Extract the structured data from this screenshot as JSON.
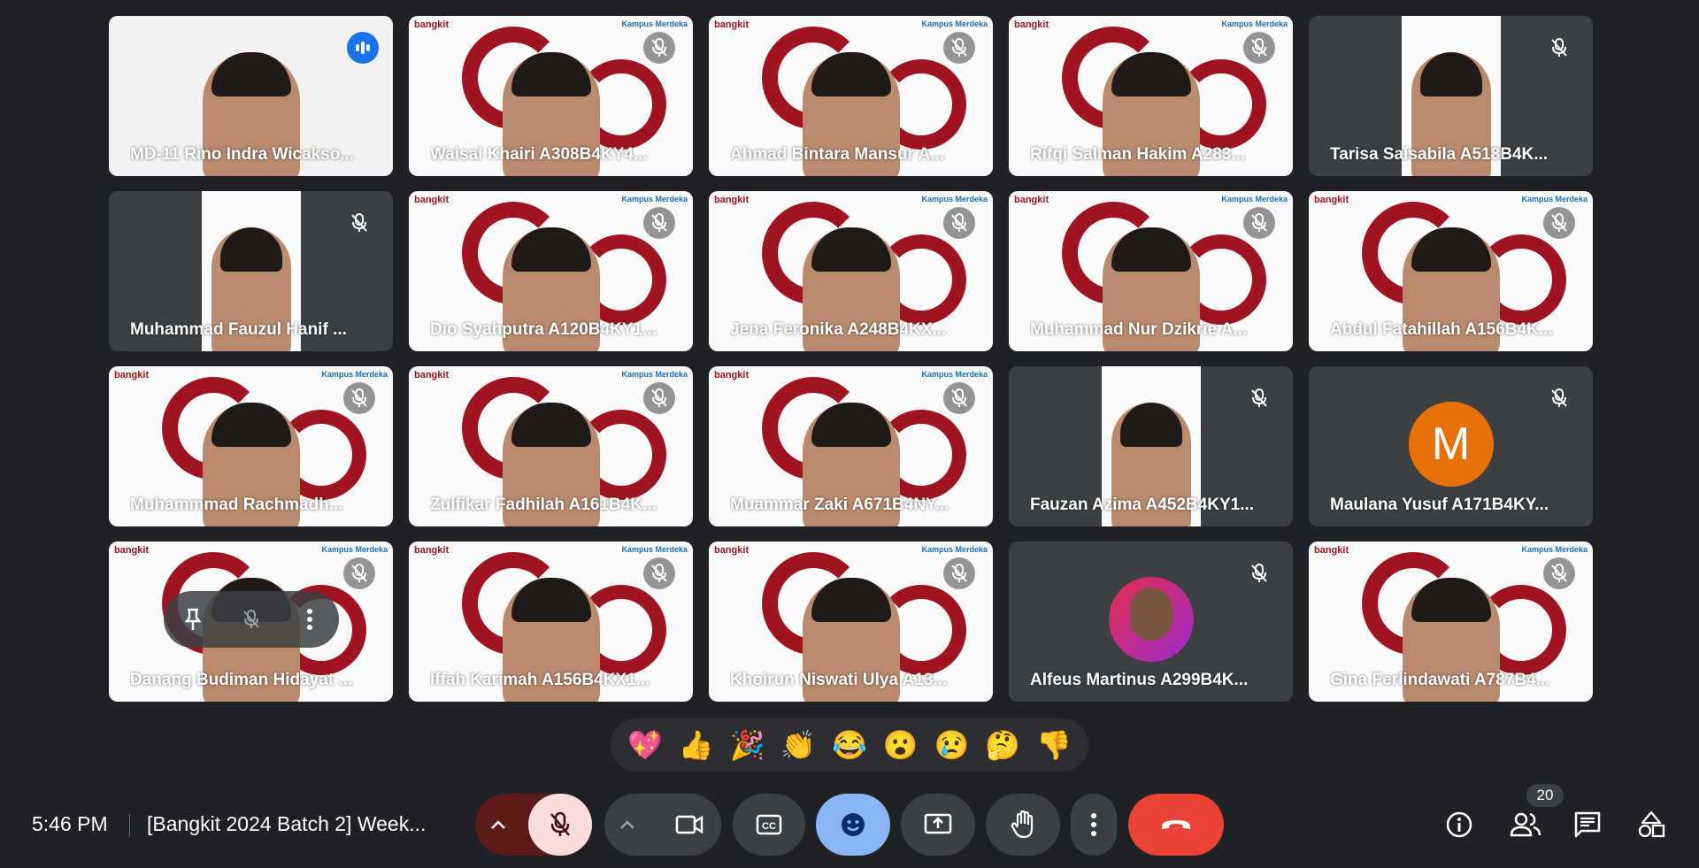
{
  "participants": [
    {
      "name": "MD-11 Rino Indra Wicakso...",
      "type": "video",
      "brand": false,
      "speaking": true
    },
    {
      "name": "Waisal Khairi A308B4KY4...",
      "type": "video",
      "brand": true,
      "muted": true
    },
    {
      "name": "Ahmad Bintara Mansur A...",
      "type": "video",
      "brand": true,
      "muted": true
    },
    {
      "name": "Rifqi Salman Hakim A283...",
      "type": "video",
      "brand": true,
      "muted": true
    },
    {
      "name": "Tarisa Salsabila A518B4K...",
      "type": "strip",
      "muted": true
    },
    {
      "name": "Muhammad Fauzul Hanif ...",
      "type": "strip",
      "muted": true
    },
    {
      "name": "Dio Syahputra A120B4KY1...",
      "type": "video",
      "brand": true,
      "muted": true
    },
    {
      "name": "Jena Feronika A248B4KX...",
      "type": "video",
      "brand": true,
      "muted": true
    },
    {
      "name": "Muhammad Nur Dzikrie A...",
      "type": "video",
      "brand": true,
      "muted": true
    },
    {
      "name": "Abdul Fatahillah A156B4K...",
      "type": "video",
      "brand": true,
      "muted": true
    },
    {
      "name": "Muhammmad Rachmadh...",
      "type": "video",
      "brand": true,
      "muted": true
    },
    {
      "name": "Zulfikar Fadhilah A161B4K...",
      "type": "video",
      "brand": true,
      "muted": true
    },
    {
      "name": "Muammar Zaki A671B4NY...",
      "type": "video",
      "brand": true,
      "muted": true
    },
    {
      "name": "Fauzan Azima A452B4KY1...",
      "type": "strip",
      "muted": true
    },
    {
      "name": "Maulana Yusuf A171B4KY...",
      "type": "letter",
      "letter": "M",
      "muted": true
    },
    {
      "name": "Danang Budiman Hidayat ...",
      "type": "video",
      "brand": true,
      "muted": true,
      "hover": true
    },
    {
      "name": "Iffah Karimah A156B4KX1...",
      "type": "video",
      "brand": true,
      "muted": true
    },
    {
      "name": "Khoirun Niswati Ulya A13...",
      "type": "video",
      "brand": true,
      "muted": true
    },
    {
      "name": "Alfeus Martinus A299B4K...",
      "type": "photo",
      "muted": true
    },
    {
      "name": "Gina Ferlindawati A787B4...",
      "type": "video",
      "brand": true,
      "muted": true
    }
  ],
  "brand": {
    "left": "bangkit",
    "right": "Kampus Merdeka"
  },
  "reactions": [
    "💖",
    "👍",
    "🎉",
    "👏",
    "😂",
    "😮",
    "😢",
    "🤔",
    "👎"
  ],
  "bottom_bar": {
    "time": "5:46 PM",
    "meeting_title": "[Bangkit 2024 Batch 2] Week...",
    "people_count": "20"
  },
  "colors": {
    "end_call": "#ea4335",
    "accent": "#8ab4f8",
    "mic_off_bg": "#f9dedc"
  }
}
